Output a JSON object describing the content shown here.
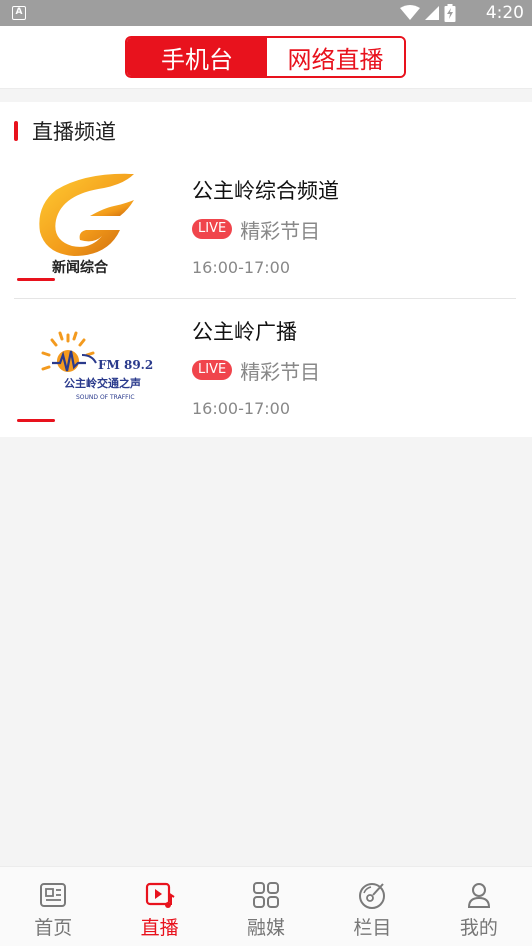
{
  "status_bar": {
    "badge": "A",
    "time": "4:20"
  },
  "header": {
    "tabs": [
      {
        "label": "手机台",
        "active": true
      },
      {
        "label": "网络直播",
        "active": false
      }
    ]
  },
  "section": {
    "title": "直播频道"
  },
  "channels": [
    {
      "name": "公主岭综合频道",
      "logo_text": "新闻综合",
      "live_label": "LIVE",
      "program": "精彩节目",
      "time": "16:00-17:00"
    },
    {
      "name": "公主岭广播",
      "logo_text": "公主岭交通之声",
      "logo_freq": "FM 89.2",
      "logo_sub": "SOUND OF TRAFFIC",
      "live_label": "LIVE",
      "program": "精彩节目",
      "time": "16:00-17:00"
    }
  ],
  "bottom_nav": {
    "items": [
      {
        "label": "首页",
        "icon": "news-icon",
        "active": false
      },
      {
        "label": "直播",
        "icon": "live-play-icon",
        "active": true
      },
      {
        "label": "融媒",
        "icon": "grid-icon",
        "active": false
      },
      {
        "label": "栏目",
        "icon": "column-disc-icon",
        "active": false
      },
      {
        "label": "我的",
        "icon": "user-icon",
        "active": false
      }
    ]
  },
  "colors": {
    "accent": "#e8121d",
    "live_badge": "#f0454c",
    "status_bar": "#9e9e9e"
  }
}
